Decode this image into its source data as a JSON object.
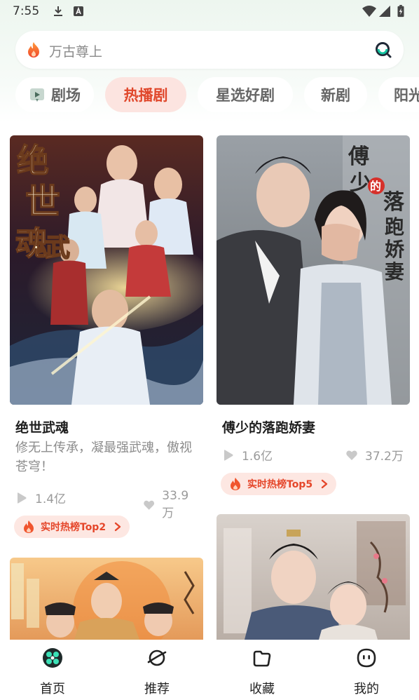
{
  "status_bar": {
    "time": "7:55",
    "icons": [
      "download-icon",
      "a-letter-icon",
      "wifi-icon",
      "signal-icon",
      "battery-charging-icon"
    ]
  },
  "search": {
    "placeholder": "万古尊上",
    "icon_left": "fire-icon",
    "icon_right": "search-icon"
  },
  "tabs": [
    {
      "label": "剧场",
      "icon": "theater-icon",
      "active": false
    },
    {
      "label": "热播剧",
      "active": true
    },
    {
      "label": "星选好剧",
      "active": false
    },
    {
      "label": "新剧",
      "active": false
    },
    {
      "label": "阳光",
      "active": false
    }
  ],
  "cards": [
    {
      "title": "绝世武魂",
      "description": "修无上传承，凝最强武魂，傲视苍穹！",
      "plays": "1.4亿",
      "likes": "33.9万",
      "rank": "实时热榜Top2",
      "poster_text": [
        "绝",
        "世",
        "武",
        "魂"
      ]
    },
    {
      "title": "傅少的落跑娇妻",
      "plays": "1.6亿",
      "likes": "37.2万",
      "rank": "实时热榜Top5",
      "poster_text": [
        "傅",
        "少",
        "的",
        "落",
        "跑",
        "娇",
        "妻"
      ]
    }
  ],
  "bottom_nav": [
    {
      "label": "首页",
      "icon": "home-icon",
      "active": true
    },
    {
      "label": "推荐",
      "icon": "planet-icon",
      "active": false
    },
    {
      "label": "收藏",
      "icon": "folder-icon",
      "active": false
    },
    {
      "label": "我的",
      "icon": "profile-face-icon",
      "active": false
    }
  ],
  "colors": {
    "accent": "#e0472b",
    "accent_bg": "#fce4e0",
    "search_green": "#14c4a0"
  }
}
